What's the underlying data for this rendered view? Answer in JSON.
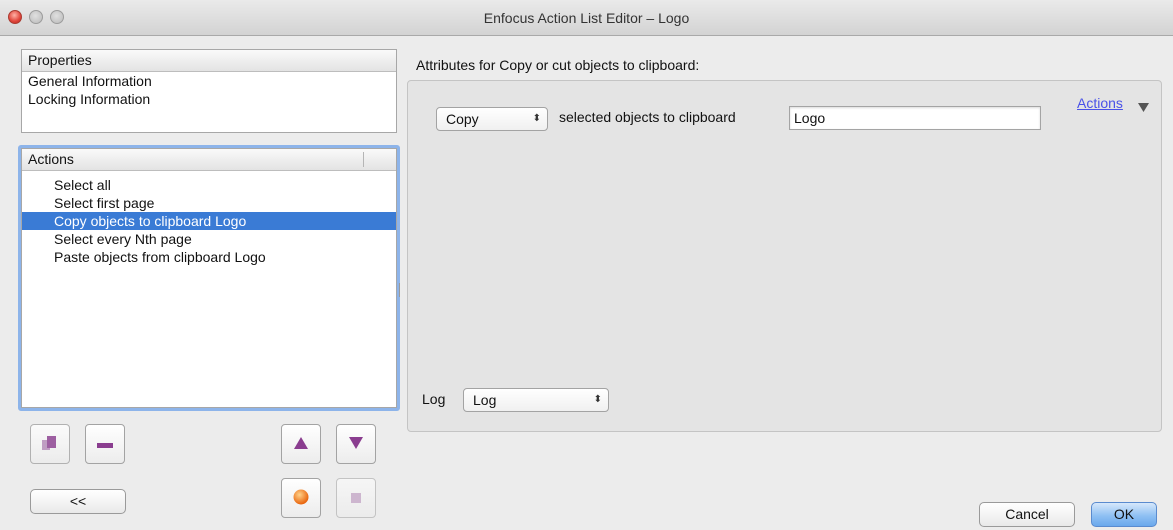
{
  "window": {
    "title": "Enfocus Action List Editor – Logo"
  },
  "properties": {
    "header": "Properties",
    "items": [
      "General Information",
      "Locking Information"
    ]
  },
  "actions_list": {
    "header": "Actions",
    "items": [
      {
        "label": "Select all",
        "selected": false
      },
      {
        "label": "Select first page",
        "selected": false
      },
      {
        "label": "Copy objects to clipboard Logo",
        "selected": true
      },
      {
        "label": "Select every Nth page",
        "selected": false
      },
      {
        "label": "Paste objects from clipboard Logo",
        "selected": false
      }
    ]
  },
  "attributes": {
    "heading": "Attributes for Copy or cut objects to clipboard:",
    "mode_select": "Copy",
    "mode_label": "selected objects to clipboard",
    "clipboard_name": "Logo",
    "actions_menu": "Actions",
    "log_label": "Log",
    "log_select": "Log"
  },
  "buttons": {
    "collapse": "<<",
    "cancel": "Cancel",
    "ok": "OK"
  },
  "icons": {
    "add": "copy-add-icon",
    "remove": "minus-icon",
    "move_up": "triangle-up-icon",
    "move_down": "triangle-down-icon",
    "record": "record-icon",
    "stop": "stop-icon"
  },
  "colors": {
    "selection": "#3a7bd5",
    "accent_purple": "#8a3d8f",
    "link": "#4a52e8",
    "record": "#f07a12"
  }
}
